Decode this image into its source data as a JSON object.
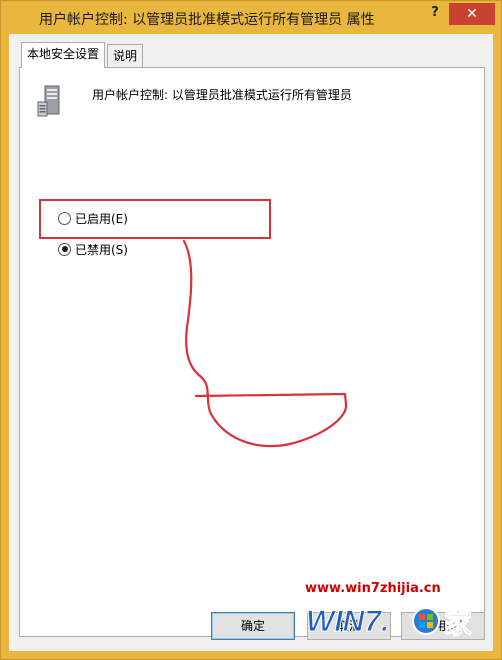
{
  "window": {
    "title": "用户帐户控制: 以管理员批准模式运行所有管理员 属性",
    "help_label": "?",
    "close_label": "✕"
  },
  "tabs": [
    {
      "label": "本地安全设置",
      "active": true
    },
    {
      "label": "说明",
      "active": false
    }
  ],
  "panel": {
    "policy_name": "用户帐户控制: 以管理员批准模式运行所有管理员",
    "icon": "server-policy-icon",
    "options": [
      {
        "label": "已启用(E)",
        "checked": false
      },
      {
        "label": "已禁用(S)",
        "checked": true
      }
    ]
  },
  "buttons": {
    "ok": "确定",
    "cancel": "取消",
    "apply": "应用(A)"
  },
  "watermark": {
    "url": "www.win7zhijia.cn",
    "logo_text": "WIN7.",
    "logo_suffix": "家"
  },
  "colors": {
    "title_bar": "#e9b63e",
    "close_button": "#c7432f",
    "annotation": "#d8323a",
    "watermark": "#d10000"
  }
}
